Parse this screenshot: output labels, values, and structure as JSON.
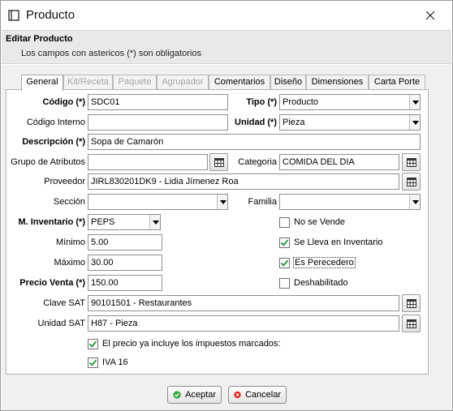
{
  "window": {
    "title": "Producto"
  },
  "header": {
    "title": "Editar Producto",
    "subtitle": "Los campos con astericos (*) son obligatorios"
  },
  "tabs": [
    {
      "label": "General",
      "state": "active"
    },
    {
      "label": "Kit/Receta",
      "state": "disabled"
    },
    {
      "label": "Paquete",
      "state": "disabled"
    },
    {
      "label": "Agrupador",
      "state": "disabled"
    },
    {
      "label": "Comentarios",
      "state": "enabled"
    },
    {
      "label": "Diseño",
      "state": "enabled"
    },
    {
      "label": "Dimensiones",
      "state": "enabled"
    },
    {
      "label": "Carta Porte",
      "state": "enabled"
    }
  ],
  "form": {
    "codigo": {
      "label": "Código (*)",
      "value": "SDC01"
    },
    "tipo": {
      "label": "Tipo (*)",
      "value": "Producto"
    },
    "codigo_interno": {
      "label": "Código Interno",
      "value": ""
    },
    "unidad": {
      "label": "Unidad (*)",
      "value": "Pieza"
    },
    "descripcion": {
      "label": "Descripción (*)",
      "value": "Sopa de Camarón"
    },
    "grupo_atributos": {
      "label": "Grupo de Atributos",
      "value": ""
    },
    "categoria": {
      "label": "Categoria",
      "value": "COMIDA DEL DIA"
    },
    "proveedor": {
      "label": "Proveedor",
      "value": "JIRL830201DK9 - Lidia Jímenez Roa"
    },
    "seccion": {
      "label": "Sección",
      "value": ""
    },
    "familia": {
      "label": "Familia",
      "value": ""
    },
    "m_inventario": {
      "label": "M. Inventario (*)",
      "value": "PEPS"
    },
    "minimo": {
      "label": "Mínimo",
      "value": "5.00"
    },
    "maximo": {
      "label": "Máximo",
      "value": "30.00"
    },
    "precio_venta": {
      "label": "Precio Venta (*)",
      "value": "150.00"
    },
    "clave_sat": {
      "label": "Clave SAT",
      "value": "90101501 - Restaurantes"
    },
    "unidad_sat": {
      "label": "Unidad SAT",
      "value": "H87 - Pieza"
    }
  },
  "checks": {
    "no_se_vende": {
      "label": "No se Vende",
      "checked": false
    },
    "se_lleva_inventario": {
      "label": "Se Lleva en Inventario",
      "checked": true
    },
    "es_perecedero": {
      "label": "Es Perecedero",
      "checked": true
    },
    "deshabilitado": {
      "label": "Deshabilitado",
      "checked": false
    },
    "precio_incluye_impuestos": {
      "label": "El precio ya incluye los impuestos marcados:",
      "checked": true
    },
    "iva16": {
      "label": "IVA 16",
      "checked": true
    }
  },
  "buttons": {
    "accept": "Aceptar",
    "cancel": "Cancelar"
  },
  "icons": {
    "app": "window-icon",
    "close": "close-icon",
    "picker": "table-picker-icon",
    "accept": "check-circle-icon",
    "cancel": "x-circle-icon"
  },
  "colors": {
    "check_green": "#1f8f3a",
    "accept_green": "#3aa64a",
    "cancel_red": "#d9261c"
  }
}
